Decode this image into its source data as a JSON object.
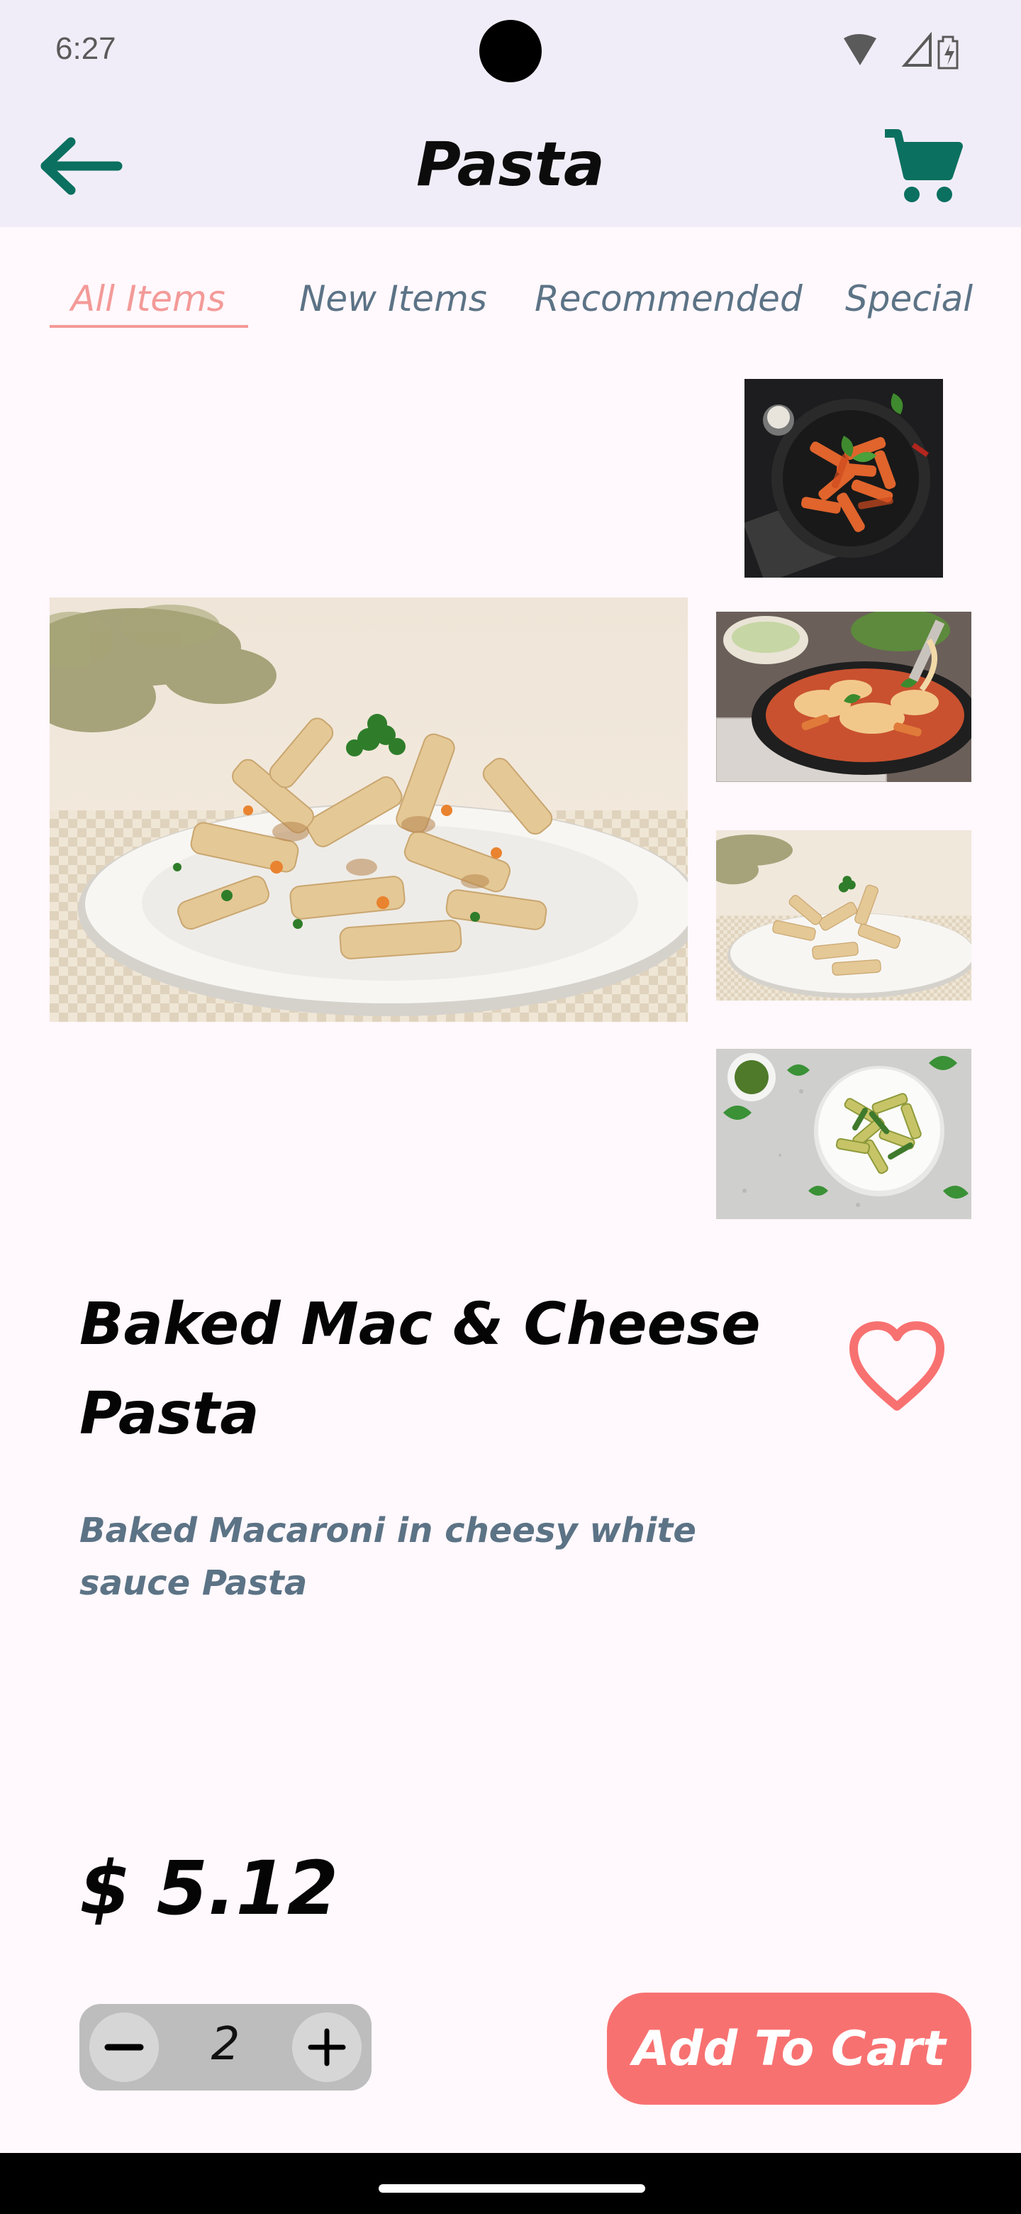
{
  "status_bar": {
    "time": "6:27"
  },
  "app_bar": {
    "title": "Pasta"
  },
  "tabs": [
    {
      "label": "All Items",
      "active": true
    },
    {
      "label": "New Items",
      "active": false
    },
    {
      "label": "Recommended",
      "active": false
    },
    {
      "label": "Special",
      "active": false
    }
  ],
  "gallery": {
    "main_image": "creamy-penne-plate",
    "thumbnails": [
      "penne-arrabbiata-pan",
      "baked-cheesy-pasta-skillet",
      "creamy-penne-plate",
      "pesto-penne-bowl"
    ]
  },
  "product": {
    "name": "Baked Mac & Cheese Pasta",
    "description": "Baked Macaroni in cheesy white sauce Pasta",
    "price": "$ 5.12",
    "quantity": "2",
    "add_to_cart_label": "Add To Cart"
  },
  "colors": {
    "accent": "#F87171",
    "app_bar_bg": "#F1EDF8",
    "icon_teal": "#0B7060",
    "tab_inactive": "#5C7386",
    "tab_active": "#F39A98",
    "page_bg": "#FFF8FC"
  }
}
